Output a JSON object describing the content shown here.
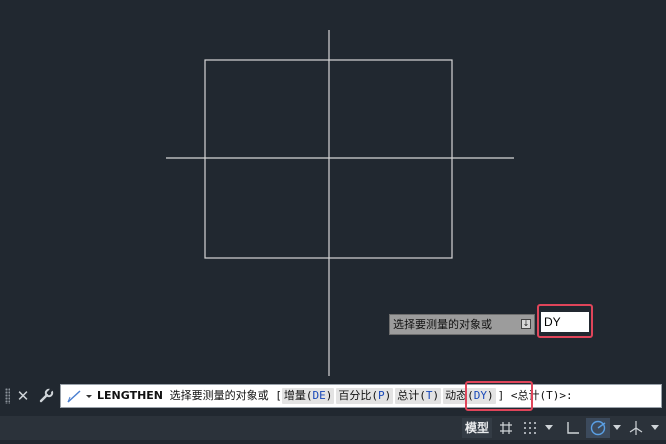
{
  "dynamic_input": {
    "prompt": "选择要测量的对象或",
    "prompt_icon": "download-arrow-icon",
    "value": "DY"
  },
  "command_line": {
    "command": "LENGTHEN",
    "prompt": "选择要测量的对象或",
    "bracket_open": "[",
    "bracket_close": "]",
    "options": [
      {
        "label": "增量(",
        "key": "DE",
        "close": ")"
      },
      {
        "label": "百分比(",
        "key": "P",
        "close": ")"
      },
      {
        "label": "总计(",
        "key": "T",
        "close": ")"
      },
      {
        "label": "动态(",
        "key": "DY",
        "close": ")"
      }
    ],
    "default": "<总计(T)>:",
    "close_icon": "close-icon",
    "customize_icon": "wrench-icon",
    "recent_icon": "command-pencil-icon"
  },
  "status_bar": {
    "model_label": "模型",
    "buttons": [
      {
        "icon": "grid-icon"
      },
      {
        "icon": "snap-dots-icon"
      },
      {
        "icon": "ortho-icon"
      },
      {
        "icon": "polar-tracking-icon"
      },
      {
        "icon": "isodraft-icon"
      }
    ]
  },
  "colors": {
    "canvas_bg": "#212830",
    "geometry": "#d6d6d6",
    "highlight": "#e0455a",
    "option_key": "#1747b8"
  }
}
